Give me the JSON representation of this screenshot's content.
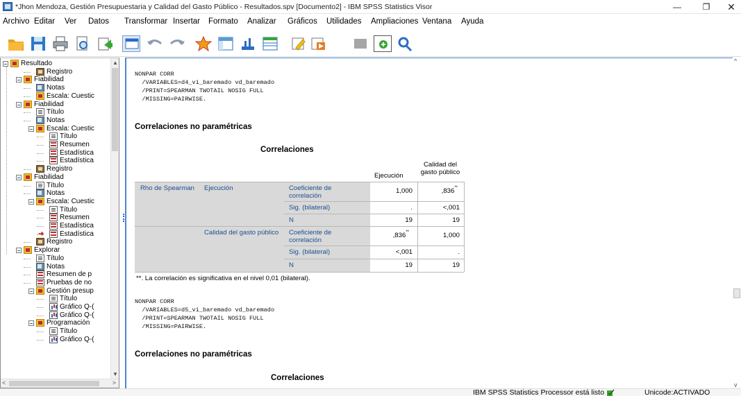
{
  "window": {
    "title": "*Jhon Mendoza, Gestión Presupuestaria y Calidad del Gasto Público - Resultados.spv [Documento2] - IBM SPSS Statistics Visor",
    "minimize": "—",
    "maximize": "❐",
    "close": "✕"
  },
  "menu": [
    "Archivo",
    "Editar",
    "Ver",
    "Datos",
    "Transformar",
    "Insertar",
    "Formato",
    "Analizar",
    "Gráficos",
    "Utilidades",
    "Ampliaciones",
    "Ventana",
    "Ayuda"
  ],
  "toolbar_icons": [
    "open-icon",
    "save-icon",
    "print-icon",
    "print-preview-icon",
    "export-icon",
    "recall-dialog-icon",
    "undo-icon",
    "redo-icon",
    "goto-case-icon",
    "goto-variable-icon",
    "variables-icon",
    "insert-output-icon",
    "designate-window-icon",
    "run-icon",
    "pivot-icon",
    "add-icon",
    "find-icon"
  ],
  "tree": [
    {
      "label": "Resultado",
      "icon": "folder"
    },
    {
      "label": "Registro",
      "icon": "registro"
    },
    {
      "label": "Fiabilidad",
      "icon": "folder"
    },
    {
      "label": "Notas",
      "icon": "notas"
    },
    {
      "label": "Escala: Cuestic",
      "icon": "folder"
    },
    {
      "label": "Fiabilidad",
      "icon": "folder"
    },
    {
      "label": "Título",
      "icon": "titulo"
    },
    {
      "label": "Notas",
      "icon": "notas"
    },
    {
      "label": "Escala: Cuestic",
      "icon": "folder"
    },
    {
      "label": "Título",
      "icon": "titulo"
    },
    {
      "label": "Resumen",
      "icon": "table"
    },
    {
      "label": "Estadística",
      "icon": "table"
    },
    {
      "label": "Estadística",
      "icon": "table"
    },
    {
      "label": "Registro",
      "icon": "registro"
    },
    {
      "label": "Fiabilidad",
      "icon": "folder"
    },
    {
      "label": "Título",
      "icon": "titulo"
    },
    {
      "label": "Notas",
      "icon": "notas"
    },
    {
      "label": "Escala: Cuestic",
      "icon": "folder"
    },
    {
      "label": "Título",
      "icon": "titulo"
    },
    {
      "label": "Resumen",
      "icon": "table"
    },
    {
      "label": "Estadística",
      "icon": "table"
    },
    {
      "label": "Estadística",
      "icon": "table"
    },
    {
      "label": "Registro",
      "icon": "registro"
    },
    {
      "label": "Explorar",
      "icon": "folder"
    },
    {
      "label": "Título",
      "icon": "titulo"
    },
    {
      "label": "Notas",
      "icon": "notas"
    },
    {
      "label": "Resumen de p",
      "icon": "table"
    },
    {
      "label": "Pruebas de no",
      "icon": "table"
    },
    {
      "label": "Gestión presup",
      "icon": "folder"
    },
    {
      "label": "Título",
      "icon": "titulo"
    },
    {
      "label": "Gráfico Q-(",
      "icon": "chart"
    },
    {
      "label": "Gráfico Q-(",
      "icon": "chart"
    },
    {
      "label": "Programación",
      "icon": "folder"
    },
    {
      "label": "Título",
      "icon": "titulo"
    },
    {
      "label": "Gráfico Q-(",
      "icon": "chart"
    }
  ],
  "output": {
    "syntax1": "NONPAR CORR\n  /VARIABLES=d4_vi_baremado vd_baremado\n  /PRINT=SPEARMAN TWOTAIL NOSIG FULL\n  /MISSING=PAIRWISE.",
    "heading1": "Correlaciones no paramétricas",
    "table_title": "Correlaciones",
    "table": {
      "col_headers": [
        "Ejecución",
        "Calidad del gasto público"
      ],
      "rho_label": "Rho de Spearman",
      "row1_label": "Ejecución",
      "row2_label": "Calidad del gasto público",
      "stat_coef": "Coeficiente de correlación",
      "stat_sig": "Sig. (bilateral)",
      "stat_n": "N",
      "values": {
        "r1_coef": [
          "1,000",
          ",836"
        ],
        "r1_sig": [
          ".",
          "<,001"
        ],
        "r1_n": [
          "19",
          "19"
        ],
        "r2_coef": [
          ",836",
          "1,000"
        ],
        "r2_sig": [
          "<,001",
          "."
        ],
        "r2_n": [
          "19",
          "19"
        ]
      },
      "sig_marker": "**"
    },
    "footnote": "**. La correlación es significativa en el nivel 0,01 (bilateral).",
    "syntax2": "NONPAR CORR\n  /VARIABLES=d5_vi_baremado vd_baremado\n  /PRINT=SPEARMAN TWOTAIL NOSIG FULL\n  /MISSING=PAIRWISE.",
    "heading2": "Correlaciones no paramétricas",
    "table_title2": "Correlaciones"
  },
  "status": {
    "processor": "IBM SPSS Statistics Processor está listo",
    "unicode": "Unicode:ACTIVADO"
  },
  "colors": {
    "accent_blue": "#4a86c8",
    "stub_gray": "#d9d9d9",
    "folder_red": "#c1272d"
  }
}
